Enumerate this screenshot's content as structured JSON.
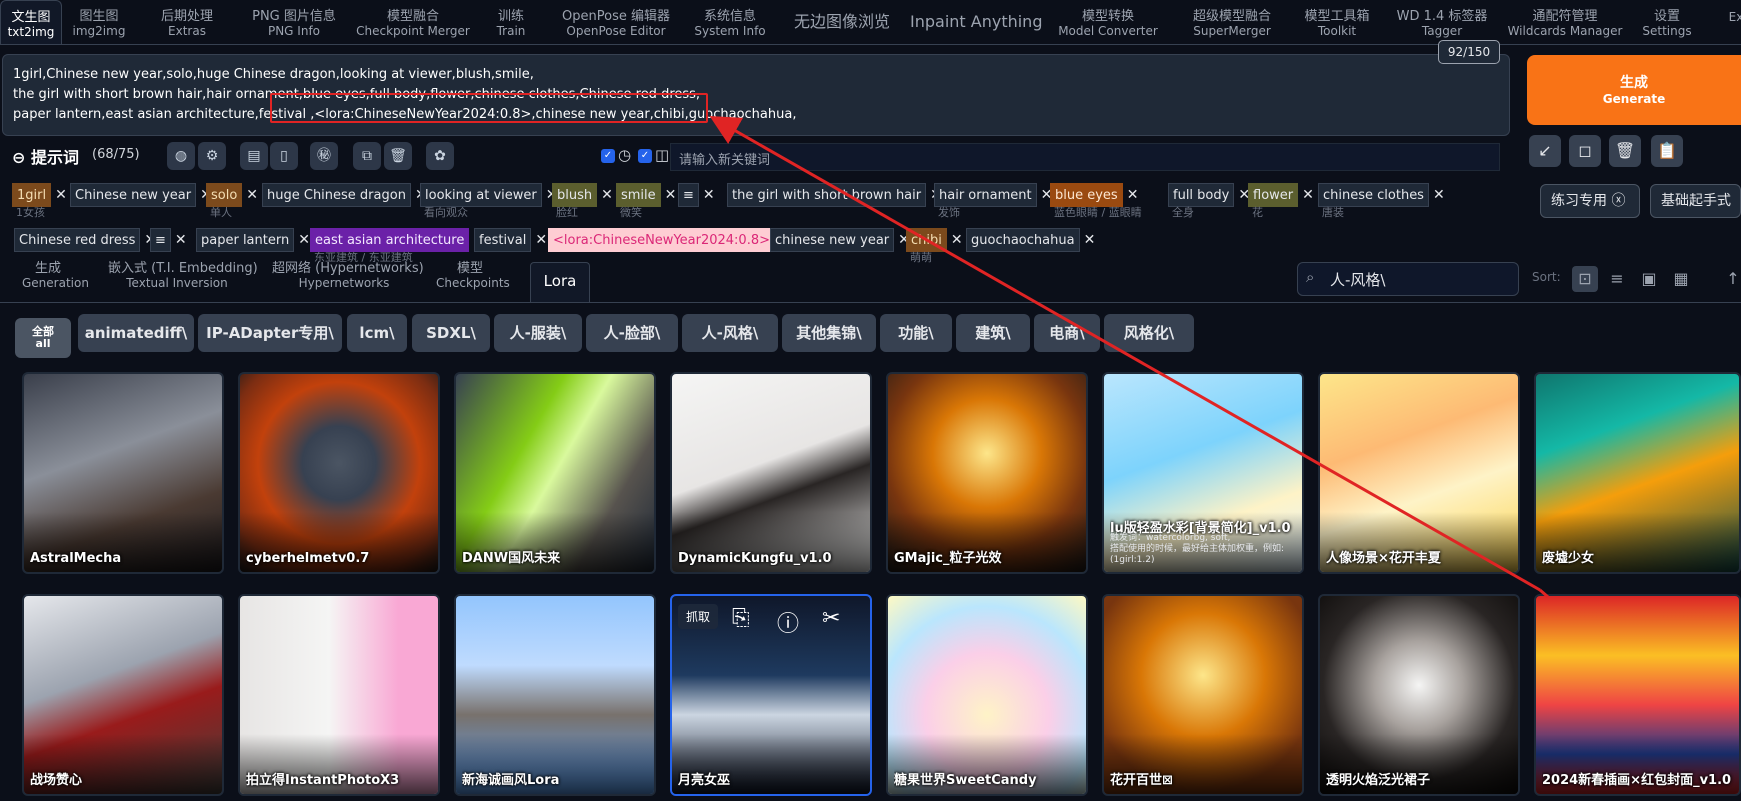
{
  "top_tabs": [
    {
      "zh": "文生图",
      "en": "txt2img"
    },
    {
      "zh": "图生图",
      "en": "img2img"
    },
    {
      "zh": "后期处理",
      "en": "Extras"
    },
    {
      "zh": "PNG 图片信息",
      "en": "PNG Info"
    },
    {
      "zh": "模型融合",
      "en": "Checkpoint Merger"
    },
    {
      "zh": "训练",
      "en": "Train"
    },
    {
      "zh": "OpenPose 编辑器",
      "en": "OpenPose Editor"
    },
    {
      "zh": "系统信息",
      "en": "System Info"
    },
    {
      "zh": "无边图像浏览",
      "en": ""
    },
    {
      "zh": "Inpaint Anything",
      "en": ""
    },
    {
      "zh": "模型转换",
      "en": "Model Converter"
    },
    {
      "zh": "超级模型融合",
      "en": "SuperMerger"
    },
    {
      "zh": "模型工具箱",
      "en": "Toolkit"
    },
    {
      "zh": "WD 1.4 标签器",
      "en": "Tagger"
    },
    {
      "zh": "通配符管理",
      "en": "Wildcards Manager"
    },
    {
      "zh": "设置",
      "en": "Settings"
    },
    {
      "zh": "",
      "en": "Exte"
    }
  ],
  "prompt": {
    "lines": [
      "1girl,Chinese new year,solo,huge Chinese dragon,looking at viewer,blush,smile,",
      "the girl with short brown hair,hair ornament,blue eyes,full body,flower,chinese clothes,Chinese red dress,",
      "paper lantern,east asian architecture,festival ,<lora:ChineseNewYear2024:0.8>,chinese new year,chibi,guochaochahua,"
    ],
    "token_count": "92/150",
    "header": "提示词",
    "count": "(68/75)",
    "tag_input_placeholder": "请输入新关键词"
  },
  "generate": {
    "zh": "生成",
    "en": "Generate"
  },
  "right_chips": [
    "练习专用",
    "基础起手式"
  ],
  "tags_row1": [
    {
      "text": "1girl",
      "sub": "1女孩",
      "style": "brown"
    },
    {
      "text": "Chinese new year",
      "sub": "",
      "style": "plain"
    },
    {
      "text": "solo",
      "sub": "单人",
      "style": "brown"
    },
    {
      "text": "huge Chinese dragon",
      "sub": "",
      "style": "plain"
    },
    {
      "text": "looking at viewer",
      "sub": "看向观众",
      "style": "plain"
    },
    {
      "text": "blush",
      "sub": "脸红",
      "style": "olive"
    },
    {
      "text": "smile",
      "sub": "微笑",
      "style": "olive"
    },
    {
      "text": "≡",
      "sub": "",
      "style": "plain"
    },
    {
      "text": "the girl with short brown hair",
      "sub": "",
      "style": "plain"
    },
    {
      "text": "hair ornament",
      "sub": "发饰",
      "style": "plain"
    },
    {
      "text": "blue eyes",
      "sub": "蓝色眼睛 / 蓝眼睛",
      "style": "orange"
    },
    {
      "text": "full body",
      "sub": "全身",
      "style": "plain"
    },
    {
      "text": "flower",
      "sub": "花",
      "style": "olive"
    },
    {
      "text": "chinese clothes",
      "sub": "唐装",
      "style": "plain"
    }
  ],
  "tags_row2": [
    {
      "text": "Chinese red dress",
      "sub": "",
      "style": "plain"
    },
    {
      "text": "≡",
      "sub": "",
      "style": "plain"
    },
    {
      "text": "paper lantern",
      "sub": "",
      "style": "plain"
    },
    {
      "text": "east asian architecture",
      "sub": "东亚建筑 / 东亚建筑",
      "style": "purple"
    },
    {
      "text": "festival",
      "sub": "",
      "style": "plain"
    },
    {
      "text": "<lora:ChineseNewYear2024:0.8>",
      "sub": "",
      "style": "pink"
    },
    {
      "text": "chinese new year",
      "sub": "",
      "style": "plain"
    },
    {
      "text": "chibi",
      "sub": "萌萌",
      "style": "brown"
    },
    {
      "text": "guochaochahua",
      "sub": "",
      "style": "plain"
    }
  ],
  "subtabs": [
    {
      "zh": "生成",
      "en": "Generation"
    },
    {
      "zh": "嵌入式 (T.I. Embedding)",
      "en": "Textual Inversion"
    },
    {
      "zh": "超网络 (Hypernetworks)",
      "en": "Hypernetworks"
    },
    {
      "zh": "模型",
      "en": "Checkpoints"
    }
  ],
  "lora_tab": "Lora",
  "search": {
    "value": "人-风格\\"
  },
  "sort_label": "Sort:",
  "filter_all": {
    "zh": "全部",
    "en": "all"
  },
  "filters": [
    "animatediff\\",
    "IP-ADapter专用\\",
    "lcm\\",
    "SDXL\\",
    "人-服装\\",
    "人-脸部\\",
    "人-风格\\",
    "其他集锦\\",
    "功能\\",
    "建筑\\",
    "电商\\",
    "风格化\\"
  ],
  "cards_row1": [
    {
      "name": "AstralMecha",
      "bg": "linear-gradient(160deg,#3a3f4b,#8a8f99 40%,#4a3a32 70%,#1c1a1e)"
    },
    {
      "name": "cyberhelmetv0.7",
      "bg": "radial-gradient(circle at 50% 45%,#4b5563 0,#374151 25%,#c2410c 55%,#7c2d12 80%,#1c1917)"
    },
    {
      "name": "DANW国风未来",
      "bg": "linear-gradient(120deg,#374151,#84cc16 35%,#d9f99d 50%,#57534e 75%,#1f2937)"
    },
    {
      "name": "DynamicKungfu_v1.0",
      "bg": "linear-gradient(160deg,#f5f5f4,#e7e5e4 45%,#292524 60%,#f5f5f4)"
    },
    {
      "name": "GMajic_粒子光效",
      "bg": "radial-gradient(circle at 50% 40%,#fde68a,#d97706 35%,#78350f 65%,#1c1917)"
    },
    {
      "name": "lu版轻盈水彩[背景简化]_v1.0",
      "bg": "linear-gradient(160deg,#bae6fd,#7dd3fc 40%,#fef3c7 70%,#e0f2fe)",
      "desc": "触发词：watercolorbg, soft,\n搭配使用的时候，最好给主体加权重，例如:\n(1girl:1.2)"
    },
    {
      "name": "人像场景×花开丰夏",
      "bg": "linear-gradient(160deg,#fde68a,#fdba74 35%,#fef3c7 60%,#fcd34d)"
    },
    {
      "name": "废墟少女",
      "bg": "linear-gradient(160deg,#0f766e,#14b8a6 30%,#f59e0b 55%,#134e4a)"
    }
  ],
  "cards_row2": [
    {
      "name": "战场赞心",
      "bg": "linear-gradient(160deg,#e5e7eb,#9ca3af 40%,#991b1b 60%,#44403c)"
    },
    {
      "name": "拍立得InstantPhotoX3",
      "bg": "linear-gradient(90deg,#e7e5e4,#f5f5f4 45%,#f9a8d4 80%)"
    },
    {
      "name": "新海诚画风Lora",
      "bg": "linear-gradient(180deg,#93c5fd,#bfdbfe 35%,#78716c 60%,#60a5fa)"
    },
    {
      "name": "月亮女巫",
      "bg": "linear-gradient(180deg,#0f172a,#1e3a5f 40%,#cbd5e1 60%,#0f172a)",
      "selected": true,
      "overlay": "抓取"
    },
    {
      "name": "糖果世界SweetCandy",
      "bg": "radial-gradient(circle at 50% 60%,#fef3c7,#fbcfe8 40%,#bae6fd 70%,#fef9c3)"
    },
    {
      "name": "花开百世⊠",
      "bg": "radial-gradient(circle at 50% 40%,#fde68a,#d97706 40%,#78350f 75%)"
    },
    {
      "name": "透明火焰泛光裙子",
      "bg": "radial-gradient(circle at 50% 45%,#f5f5f4,#a8a29e 30%,#292524 65%,#0c0a09)"
    },
    {
      "name": "2024新春插画×红包封面_v1.0",
      "bg": "linear-gradient(180deg,#dc2626,#fbbf24 30%,#ef4444 55%,#1e3a8a 80%,#dc2626)"
    }
  ]
}
